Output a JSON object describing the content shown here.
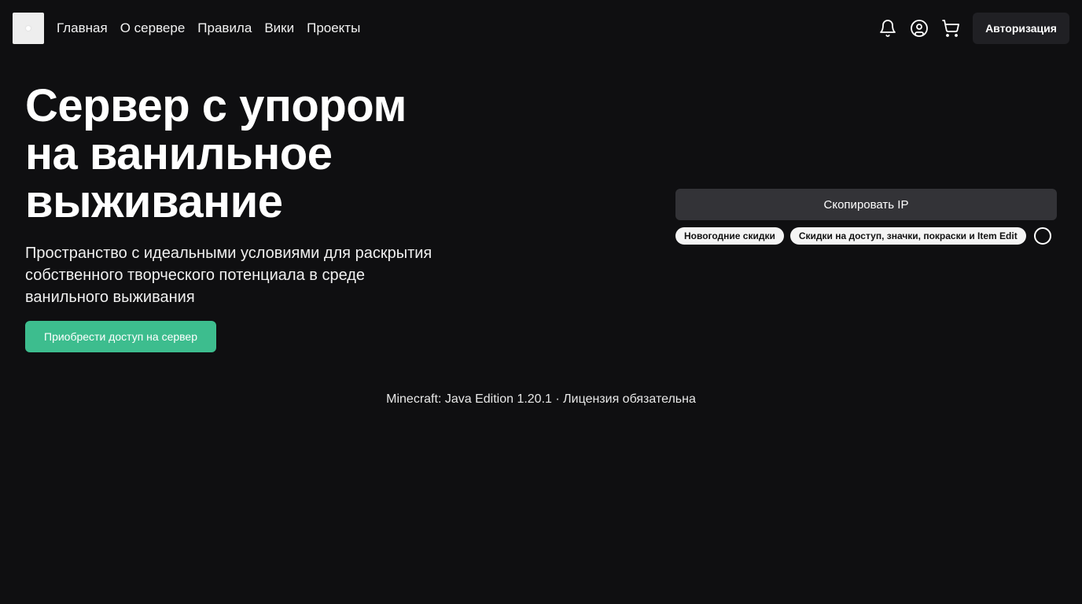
{
  "nav": {
    "items": [
      {
        "label": "Главная"
      },
      {
        "label": "О сервере"
      },
      {
        "label": "Правила"
      },
      {
        "label": "Вики"
      },
      {
        "label": "Проекты"
      }
    ]
  },
  "header": {
    "icons": [
      "bell-icon",
      "user-circle-icon",
      "cart-icon"
    ],
    "auth_label": "Авторизация"
  },
  "hero": {
    "title_lines": [
      "Сервер с упором",
      "на ванильное",
      "выживание"
    ],
    "subtitle_lines": [
      "Пространство с идеальными условиями для раскрытия",
      "собственного творческого потенциала в среде",
      "ванильного выживания"
    ],
    "cta_label": "Приобрести доступ на сервер"
  },
  "server": {
    "copy_ip_label": "Скопировать IP",
    "tags": [
      {
        "label": "Новогодние скидки"
      },
      {
        "label": "Скидки на доступ, значки, покраски и Item Edit"
      }
    ]
  },
  "footer_note": "Minecraft: Java Edition 1.20.1 · Лицензия обязательна",
  "colors": {
    "background": "#0f0f11",
    "accent_green": "#3dbd8e",
    "button_dark": "#333337",
    "auth_button": "#202024"
  }
}
